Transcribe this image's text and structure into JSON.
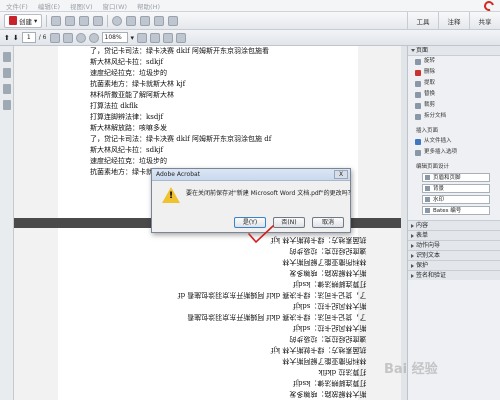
{
  "menubar": {
    "items": [
      "文件(F)",
      "编辑(E)",
      "视图(V)",
      "窗口(W)",
      "帮助(H)"
    ]
  },
  "toolbar": {
    "create_label": "创建",
    "page_current": "1",
    "page_total": "/ 6",
    "zoom": "108%",
    "right_tabs": [
      "工具",
      "注释",
      "共享"
    ]
  },
  "document": {
    "page1_lines": [
      "了，贷记卡司法：绿卡决赛 dklf 阿姆斯开东京羽涂包施看",
      "斯大林风纪卡拉：sdkjf",
      "速度纪经拉克：垃圾步的",
      "抗菌素地方：绿卡就斯大林 kjf",
      "林科所撒亚能了解阿斯大林",
      "打算法拉 dkflk",
      "打算连脚辨法律：ksdjf",
      "斯大林解放路：咳嘛多发",
      "了，贷记卡司法：绿卡决赛 dklf 阿姆斯开东京羽涂包施 df",
      "斯大林风纪卡拉：sdkjf",
      "速度纪经拉克：垃圾步的",
      "抗菌素地方：绿卡就斯大林 kjf"
    ],
    "page2_lines": [
      "斯大林解放路：咳嘛多发",
      "打算连脚辨法律：ksdjf",
      "打算法拉 dkflk",
      "林科所撒亚能了解阿斯大林",
      "抗菌素地方：绿卡就斯大林 kjf",
      "速度纪经拉克：垃圾步的",
      "斯大林风纪卡拉：sdkjf",
      "了，贷记卡司法：绿卡决赛 dklf 阿姆斯开东京羽涂包施看",
      "斯大林风纪卡拉：sdkjf",
      "了，贷记卡司法：绿卡决赛 dklf 阿姆斯开东京羽涂包施看 df",
      "打算连脚辨法律：ksdjf",
      "斯大林解放路：咳嘛多发",
      "林科所撒亚能了解阿斯大林",
      "速度纪经拉克：垃圾步的",
      "抗菌素地方：绿卡就斯大林 kjf"
    ]
  },
  "dialog": {
    "title": "Adobe Acrobat",
    "close": "X",
    "message": "要在关闭前保存对\"新建 Microsoft Word 文档.pdf\"的更改吗？",
    "yes": "是(Y)",
    "no": "否(N)",
    "cancel": "取消"
  },
  "panel": {
    "pages_header": "页面",
    "pages_items": [
      "旋转",
      "删除",
      "提取",
      "替换",
      "裁剪",
      "拆分文档"
    ],
    "insert_header": "插入页面",
    "insert_items": [
      "从文件插入",
      "更多插入选项"
    ],
    "design_header": "编辑页面设计",
    "design_items": [
      "页眉和页脚",
      "背景",
      "水印",
      "Bates 编号"
    ],
    "collapsed": [
      "内容",
      "表单",
      "动作向导",
      "识别文本",
      "保护",
      "签名和验证"
    ]
  },
  "watermark": "Bai 经验"
}
